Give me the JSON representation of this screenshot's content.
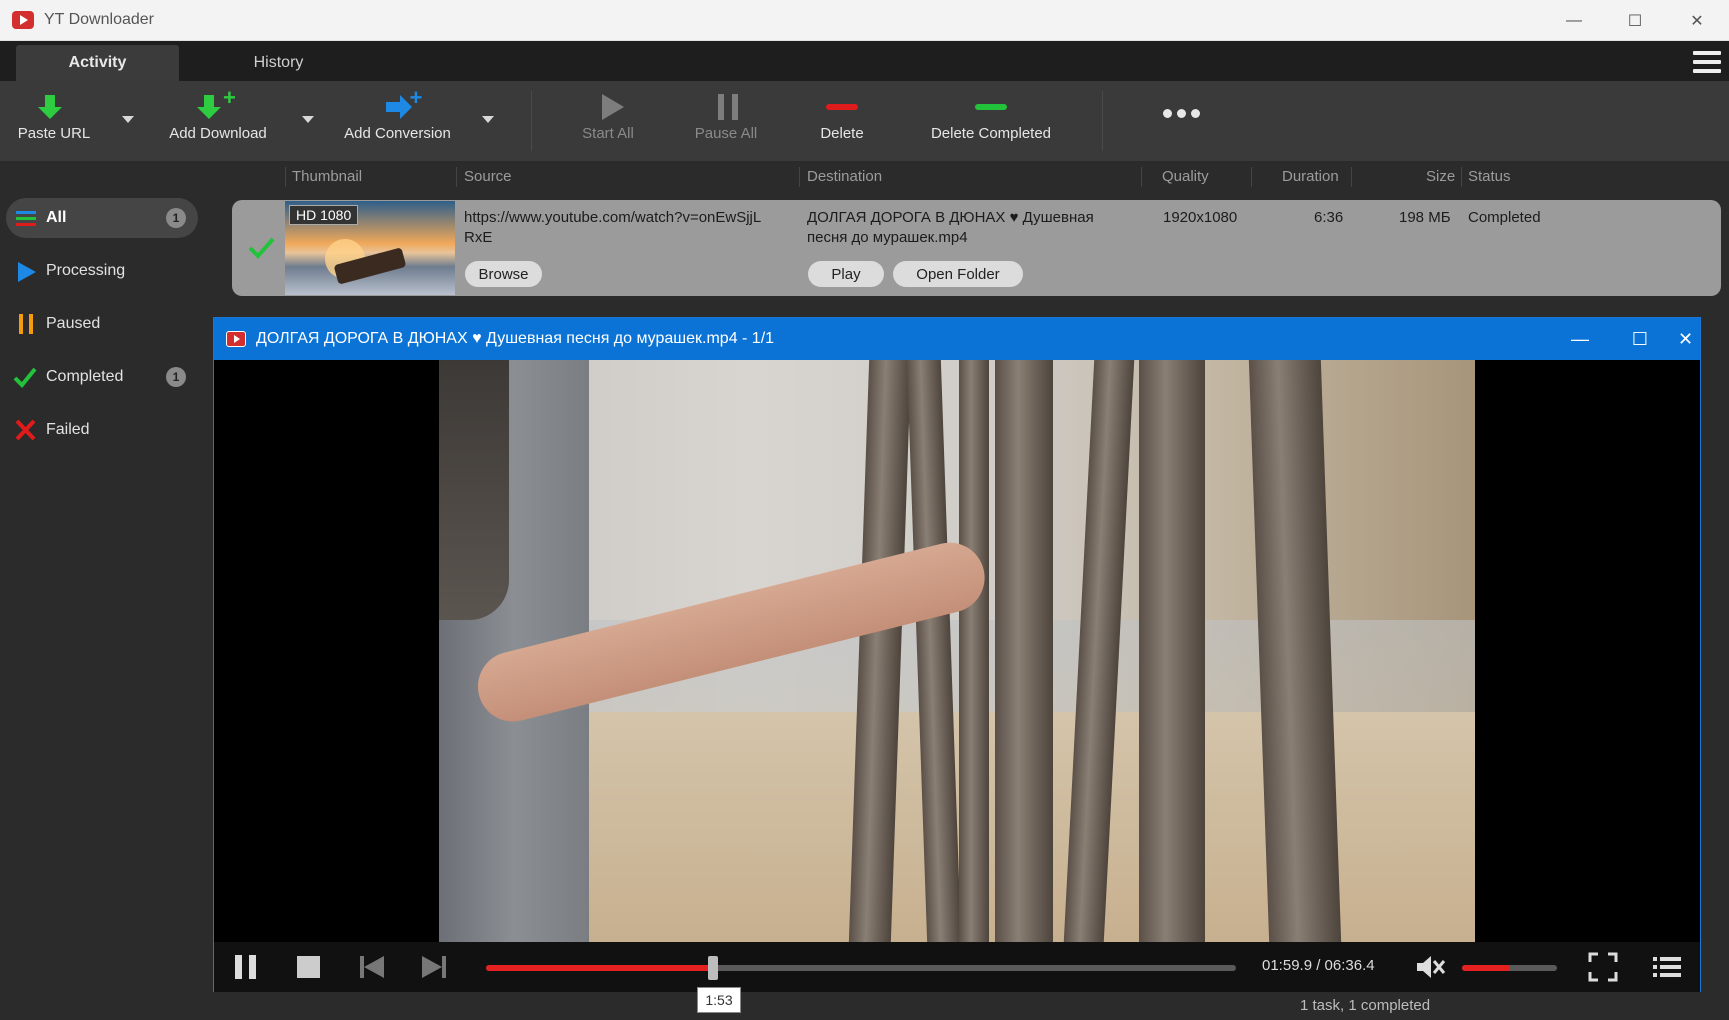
{
  "window": {
    "title": "YT Downloader",
    "minimize": "—",
    "maximize": "☐",
    "close": "✕"
  },
  "tabs": [
    {
      "label": "Activity"
    },
    {
      "label": "History"
    }
  ],
  "toolbar": {
    "paste_url": "Paste URL",
    "add_download": "Add Download",
    "add_conversion": "Add Conversion",
    "start_all": "Start All",
    "pause_all": "Pause All",
    "delete": "Delete",
    "delete_completed": "Delete Completed"
  },
  "columns": {
    "thumbnail": "Thumbnail",
    "source": "Source",
    "destination": "Destination",
    "quality": "Quality",
    "duration": "Duration",
    "size": "Size",
    "status": "Status"
  },
  "sidebar": {
    "items": [
      {
        "label": "All",
        "count": "1"
      },
      {
        "label": "Processing",
        "count": ""
      },
      {
        "label": "Paused",
        "count": ""
      },
      {
        "label": "Completed",
        "count": "1"
      },
      {
        "label": "Failed",
        "count": ""
      }
    ]
  },
  "downloads": [
    {
      "badge": "HD 1080",
      "source_line1": "https://www.youtube.com/watch?v=onEwSjjL",
      "source_line2": "RxE",
      "destination_line1": "ДОЛГАЯ ДОРОГА В ДЮНАХ ♥ Душевная",
      "destination_line2": "песня до мурашек.mp4",
      "quality": "1920x1080",
      "duration": "6:36",
      "size": "198 МБ",
      "status": "Completed",
      "browse_label": "Browse",
      "play_label": "Play",
      "open_folder_label": "Open Folder"
    }
  ],
  "player": {
    "title": "ДОЛГАЯ ДОРОГА В ДЮНАХ ♥ Душевная песня до мурашек.mp4 - 1/1",
    "time": "01:59.9 / 06:36.4",
    "progress_percent": 30.2,
    "volume_percent": 50,
    "muted": true,
    "tooltip": "1:53"
  },
  "statusbar": {
    "text": "1 task, 1 completed"
  },
  "colors": {
    "accent": "#0b73d6",
    "seek": "#e52020",
    "success": "#22c33a",
    "danger": "#e01b1b",
    "processing": "#1e88e5",
    "paused": "#f39c12"
  }
}
